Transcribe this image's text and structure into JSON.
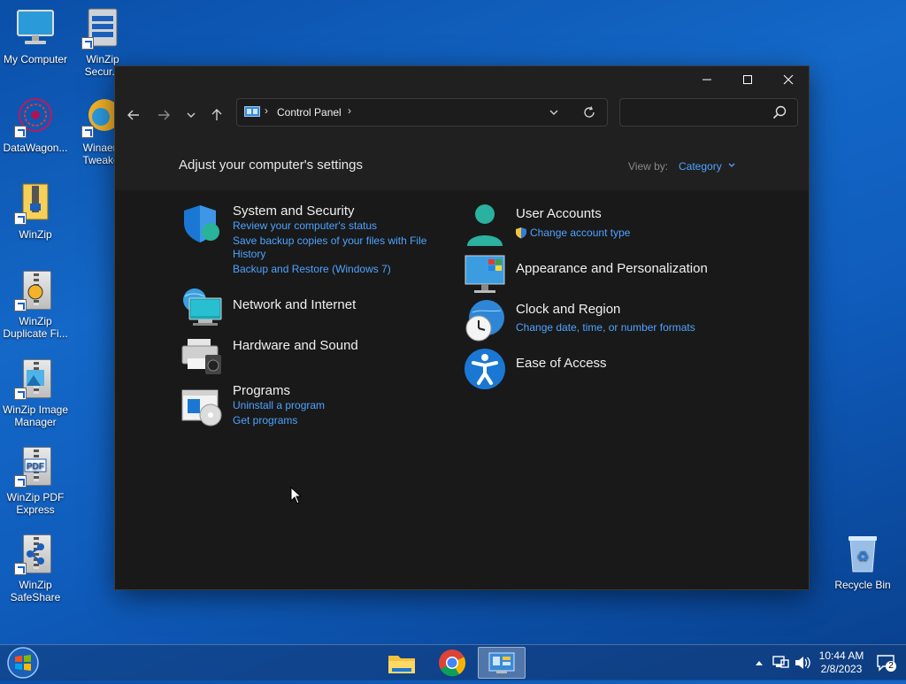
{
  "desktop": {
    "icons": [
      {
        "label": "My Computer"
      },
      {
        "label": "WinZip Secur..."
      },
      {
        "label": "DataWagon..."
      },
      {
        "label": "Winaero Tweaker"
      },
      {
        "label": "WinZip"
      },
      {
        "label": "WinZip Duplicate Fi..."
      },
      {
        "label": "WinZip Image Manager"
      },
      {
        "label": "WinZip PDF Express"
      },
      {
        "label": "WinZip SafeShare"
      },
      {
        "label": "Recycle Bin"
      }
    ]
  },
  "window": {
    "address": {
      "root": "Control Panel"
    },
    "search": {
      "placeholder": ""
    },
    "header": {
      "title": "Adjust your computer's settings",
      "view_by_label": "View by:",
      "view_by_value": "Category"
    },
    "categories": [
      {
        "name": "System and Security",
        "icon": "shield-icon",
        "links": [
          "Review your computer's status",
          "Save backup copies of your files with File",
          "History",
          "Backup and Restore (Windows 7)"
        ]
      },
      {
        "name": "Network and Internet",
        "icon": "network-icon",
        "links": []
      },
      {
        "name": "Hardware and Sound",
        "icon": "printer-icon",
        "links": []
      },
      {
        "name": "Programs",
        "icon": "programs-icon",
        "links": [
          "Uninstall a program",
          "Get programs"
        ]
      },
      {
        "name": "User Accounts",
        "icon": "user-icon",
        "links": [
          "Change account type"
        ]
      },
      {
        "name": "Appearance and Personalization",
        "icon": "monitor-icon",
        "links": []
      },
      {
        "name": "Clock and Region",
        "icon": "clock-globe-icon",
        "links": [
          "Change date, time, or number formats"
        ]
      },
      {
        "name": "Ease of Access",
        "icon": "accessibility-icon",
        "links": []
      }
    ]
  },
  "taskbar": {
    "clock": {
      "time": "10:44 AM",
      "date": "2/8/2023"
    },
    "notification_count": "2"
  },
  "colors": {
    "link": "#4da3ff",
    "window_bg": "#191919",
    "accent": "#0a6fd6"
  }
}
